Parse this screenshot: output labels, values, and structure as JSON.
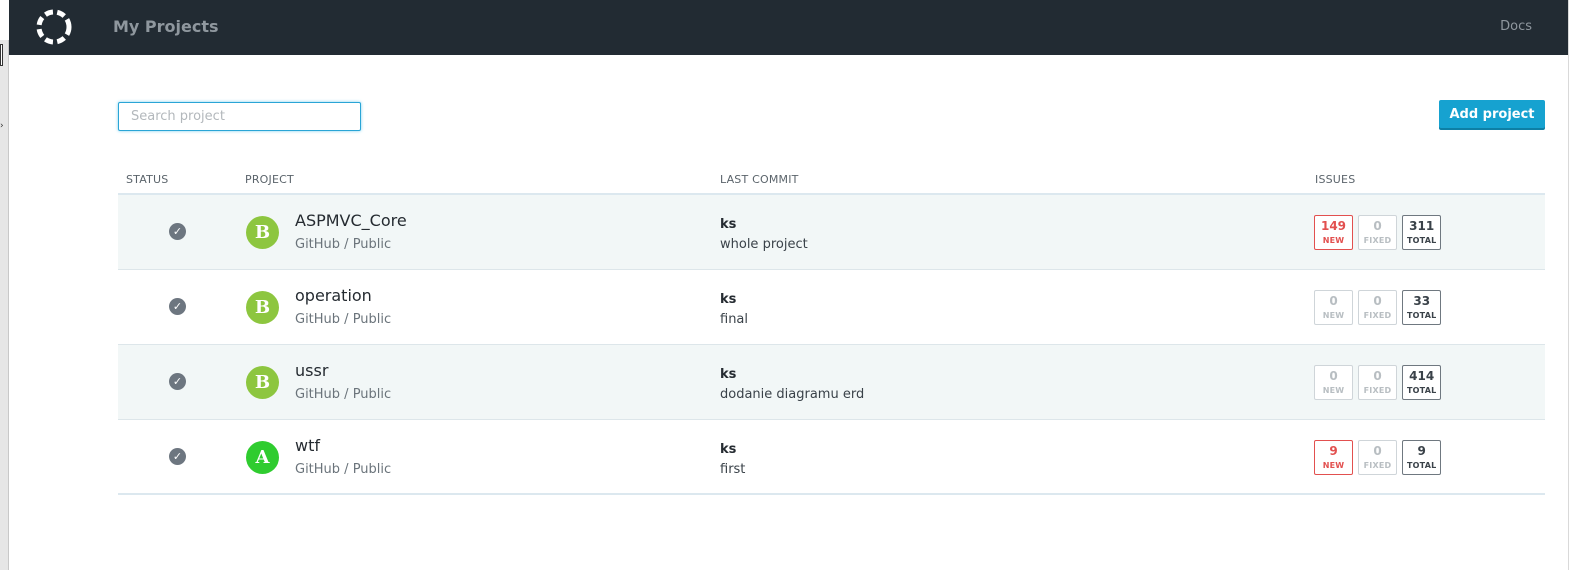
{
  "header": {
    "title": "My Projects",
    "docs_label": "Docs"
  },
  "toolbar": {
    "search_placeholder": "Search project",
    "search_value": "",
    "add_label": "Add project"
  },
  "colors": {
    "accent": "#16a2d0",
    "grade_b": "#8dc63f",
    "grade_a": "#2fcc2f",
    "new_issue": "#e2504f"
  },
  "table": {
    "columns": {
      "status": "STATUS",
      "project": "PROJECT",
      "last_commit": "LAST COMMIT",
      "issues": "ISSUES"
    },
    "rows": [
      {
        "status_icon": "check-circle-icon",
        "grade": "B",
        "name": "ASPMVC_Core",
        "source": "GitHub / Public",
        "commit_author": "ks",
        "commit_message": "whole project",
        "issues": {
          "new": "149",
          "fixed": "0",
          "total": "311",
          "new_label": "NEW",
          "fixed_label": "FIXED",
          "total_label": "TOTAL"
        }
      },
      {
        "status_icon": "check-circle-icon",
        "grade": "B",
        "name": "operation",
        "source": "GitHub / Public",
        "commit_author": "ks",
        "commit_message": "final",
        "issues": {
          "new": "0",
          "fixed": "0",
          "total": "33",
          "new_label": "NEW",
          "fixed_label": "FIXED",
          "total_label": "TOTAL"
        }
      },
      {
        "status_icon": "check-circle-icon",
        "grade": "B",
        "name": "ussr",
        "source": "GitHub / Public",
        "commit_author": "ks",
        "commit_message": "dodanie diagramu erd",
        "issues": {
          "new": "0",
          "fixed": "0",
          "total": "414",
          "new_label": "NEW",
          "fixed_label": "FIXED",
          "total_label": "TOTAL"
        }
      },
      {
        "status_icon": "check-circle-icon",
        "grade": "A",
        "name": "wtf",
        "source": "GitHub / Public",
        "commit_author": "ks",
        "commit_message": "first",
        "issues": {
          "new": "9",
          "fixed": "0",
          "total": "9",
          "new_label": "NEW",
          "fixed_label": "FIXED",
          "total_label": "TOTAL"
        }
      }
    ]
  }
}
